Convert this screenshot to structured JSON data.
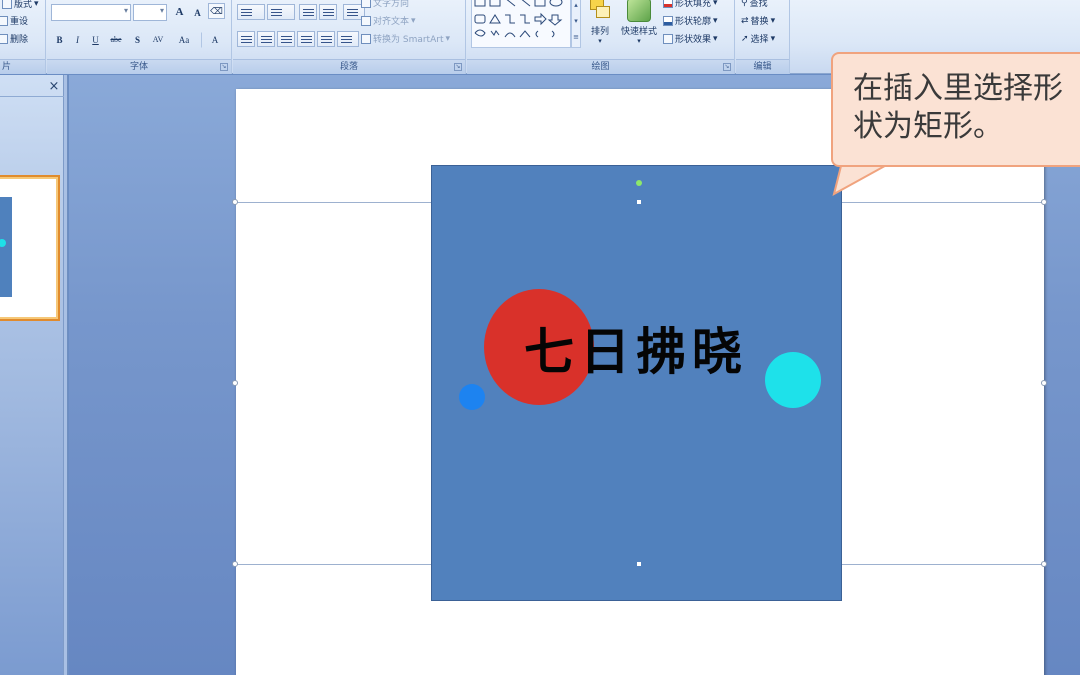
{
  "ribbon": {
    "slides_group": {
      "layout": "版式",
      "reset": "重设",
      "delete": "删除",
      "label": "片"
    },
    "font_group": {
      "label": "字体",
      "buttons": [
        "B",
        "I",
        "U",
        "abe",
        "S",
        "AV",
        "Aa",
        "A"
      ],
      "grow": "A",
      "shrink": "A"
    },
    "paragraph_group": {
      "label": "段落",
      "text_direction": "文字方向",
      "align_text": "对齐文本",
      "convert_smartart": "转换为 SmartArt"
    },
    "drawing_group": {
      "label": "绘图",
      "arrange": "排列",
      "quick_styles": "快速样式",
      "shape_fill": "形状填充",
      "shape_outline": "形状轮廓",
      "shape_effects": "形状效果"
    },
    "editing_group": {
      "label": "编辑",
      "find": "查找",
      "replace": "替换",
      "select": "选择"
    }
  },
  "slides_pane": {
    "close_glyph": "×"
  },
  "slide": {
    "logo_text": "七日拂晓"
  },
  "callout": {
    "text": "在插入里选择形状为矩形。"
  },
  "colors": {
    "rect_fill": "#5181bd",
    "red_circle": "#d9312a",
    "cyan_circle": "#1ee1ea",
    "blue_dot": "#1d83f0",
    "callout_fill": "#fbe2d4",
    "callout_border": "#f0a37e",
    "thumb_selection": "#e08b2d"
  }
}
